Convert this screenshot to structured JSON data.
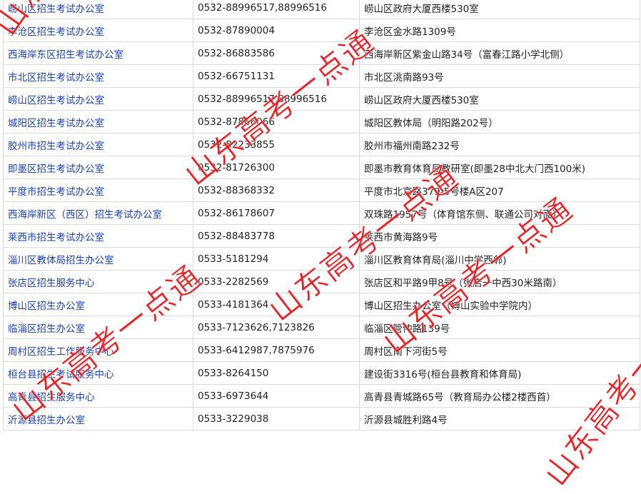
{
  "offices": [
    {
      "name": "崂山区招生考试办公室",
      "phone": "0532-88996517,88996516",
      "address": "崂山区政府大厦西楼530室"
    },
    {
      "name": "李沧区招生考试办公室",
      "phone": "0532-87890004",
      "address": "李沧区金水路1309号"
    },
    {
      "name": "西海岸东区招生考试办公室",
      "phone": "0532-86883586",
      "address": "西海岸新区紫金山路34号（富春江路小学北侧）"
    },
    {
      "name": "市北区招生考试办公室",
      "phone": "0532-66751131",
      "address": "市北区洮南路93号"
    },
    {
      "name": "崂山区招生考试办公室",
      "phone": "0532-88996517,88996516",
      "address": "崂山区政府大厦西楼530室"
    },
    {
      "name": "城阳区招生考试办公室",
      "phone": "0532-87866066",
      "address": "城阳区教体局（明阳路202号）"
    },
    {
      "name": "胶州市招生考试办公室",
      "phone": "0532-82233855",
      "address": "胶州市福州南路232号"
    },
    {
      "name": "即墨区招生考试办公室",
      "phone": "0532-81726300",
      "address": "即墨市教育体育局教研室(即墨28中北大门西100米)"
    },
    {
      "name": "平度市招生考试办公室",
      "phone": "0532-88368332",
      "address": "平度市北京路379-5号楼A区207"
    },
    {
      "name": "西海岸新区（西区）招生考试办公室",
      "phone": "0532-86178607",
      "address": "双珠路1957号（体育馆东侧、联通公司对面）"
    },
    {
      "name": "莱西市招生考试办公室",
      "phone": "0532-88483778",
      "address": "莱西市黄海路9号"
    },
    {
      "name": "淄川区教体局招生办公室",
      "phone": "0533-5181294",
      "address": "淄川区教育体育局(淄川中学西邻)"
    },
    {
      "name": "张店区招生服务中心",
      "phone": "0533-2282569",
      "address": "张店区和平路9甲8号（张店一中西30米路南）"
    },
    {
      "name": "博山区招生办公室",
      "phone": "0533-4181364",
      "address": "博山区招生办公室（博山实验中学院内）"
    },
    {
      "name": "临淄区招生办公室",
      "phone": "0533-7123626,7123826",
      "address": "临淄区管仲路139号"
    },
    {
      "name": "周村区招生工作服务中心",
      "phone": "0533-6412987,7875976",
      "address": "周村区南下河街5号"
    },
    {
      "name": "桓台县招生考试服务中心",
      "phone": "0533-8264150",
      "address": "建设街3316号(桓台县教育和体育局)"
    },
    {
      "name": "高青县招生服务中心",
      "phone": "0533-6973644",
      "address": "高青县青城路65号（教育局办公楼2楼西首）"
    },
    {
      "name": "沂源县招生办公室",
      "phone": "0533-3229038",
      "address": "沂源县城胜利路4号"
    }
  ],
  "watermark": {
    "text": "山东高考一点通",
    "color": "#e8171b"
  },
  "colors": {
    "link": "#1a3fb8",
    "border": "#d9d9d9"
  }
}
